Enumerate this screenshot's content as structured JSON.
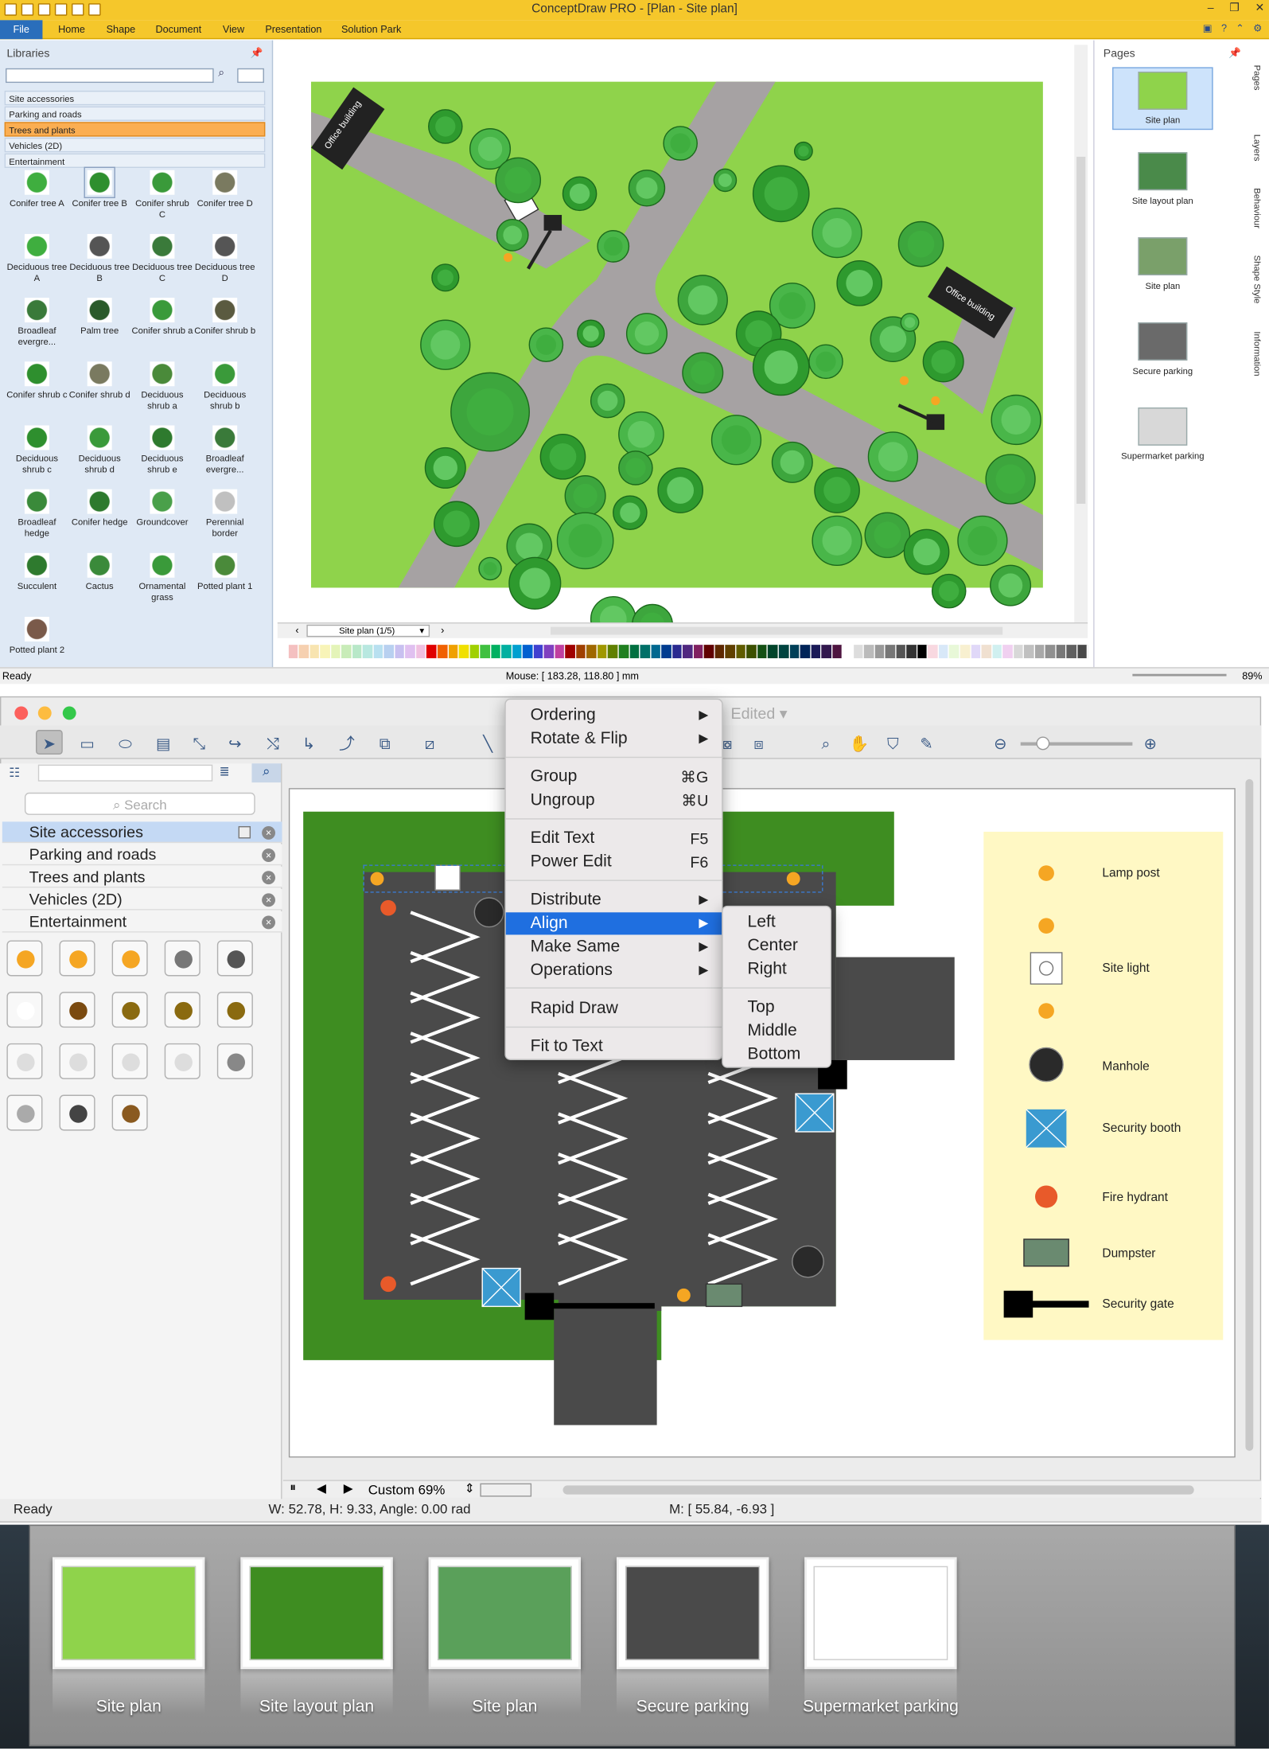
{
  "win": {
    "title": "ConceptDraw PRO - [Plan - Site plan]",
    "menu": [
      "File",
      "Home",
      "Shape",
      "Document",
      "View",
      "Presentation",
      "Solution Park"
    ],
    "libraries_header": "Libraries",
    "libraries": [
      {
        "label": "Site accessories",
        "selected": false
      },
      {
        "label": "Parking and roads",
        "selected": false
      },
      {
        "label": "Trees and plants",
        "selected": true
      },
      {
        "label": "Vehicles (2D)",
        "selected": false
      },
      {
        "label": "Entertainment",
        "selected": false
      }
    ],
    "shapes": [
      "Conifer tree A",
      "Conifer tree B",
      "Conifer shrub C",
      "Conifer tree D",
      "Deciduous tree A",
      "Deciduous tree B",
      "Deciduous tree C",
      "Deciduous tree D",
      "Broadleaf evergre...",
      "Palm tree",
      "Conifer shrub a",
      "Conifer shrub b",
      "Conifer shrub c",
      "Conifer shrub d",
      "Deciduous shrub a",
      "Deciduous shrub b",
      "Deciduous shrub c",
      "Deciduous shrub d",
      "Deciduous shrub e",
      "Broadleaf evergre...",
      "Broadleaf hedge",
      "Conifer hedge",
      "Groundcover",
      "Perennial border",
      "Succulent",
      "Cactus",
      "Ornamental grass",
      "Potted plant 1",
      "Potted plant 2"
    ],
    "plan_labels": [
      "Office building",
      "Office building"
    ],
    "pages_header": "Pages",
    "pages": [
      "Site plan",
      "Site layout plan",
      "Site plan",
      "Secure parking",
      "Supermarket parking"
    ],
    "side_tabs": [
      "Pages",
      "Layers",
      "Behaviour",
      "Shape Style",
      "Information"
    ],
    "page_tab": "Site plan (1/5)",
    "status_ready": "Ready",
    "status_mouse": "Mouse: [ 183.28, 118.80 ] mm",
    "zoom": "89%",
    "palette": [
      "#ffffff",
      "#f4c0c0",
      "#f6d0b0",
      "#f8e4b0",
      "#f8f4b8",
      "#e4f4b8",
      "#c8ecb8",
      "#b8e8c8",
      "#b8e8e0",
      "#b8e0f0",
      "#b8d0f0",
      "#c8c0f0",
      "#e0c0f0",
      "#f0c0e0",
      "#e00000",
      "#f06000",
      "#f0a000",
      "#f0e000",
      "#a0d000",
      "#40c040",
      "#00b060",
      "#00b0a0",
      "#00a0d0",
      "#0060d0",
      "#4040d0",
      "#8040c0",
      "#c040a0",
      "#a00000",
      "#a04000",
      "#a06800",
      "#a09800",
      "#608000",
      "#208020",
      "#007040",
      "#007068",
      "#006890",
      "#003c90",
      "#2a2a90",
      "#502880",
      "#802060",
      "#600000",
      "#5e2800",
      "#604000",
      "#605c00",
      "#3c5000",
      "#145014",
      "#00442a",
      "#004440",
      "#004058",
      "#002458",
      "#1a1a58",
      "#32184e",
      "#4e1440",
      "#ffffff",
      "#dddddd",
      "#bbbbbb",
      "#999999",
      "#777777",
      "#555555",
      "#333333",
      "#000000",
      "#f8d8e0",
      "#d8e8f8",
      "#e8f8d8",
      "#f8f0d0",
      "#e0d8f8",
      "#f0e0d0",
      "#d0f0f0",
      "#f0d0f0",
      "#d8d8d8",
      "#c0c0c0",
      "#a8a8a8",
      "#909090",
      "#787878",
      "#606060",
      "#484848"
    ]
  },
  "mac": {
    "title_suffix": "Edited",
    "search_placeholder": "Search",
    "libraries": [
      {
        "label": "Site accessories",
        "selected": true
      },
      {
        "label": "Parking and roads",
        "selected": false
      },
      {
        "label": "Trees and plants",
        "selected": false
      },
      {
        "label": "Vehicles (2D)",
        "selected": false
      },
      {
        "label": "Entertainment",
        "selected": false
      }
    ],
    "context_menu": [
      {
        "label": "Ordering",
        "shortcut": "",
        "submenu": true
      },
      {
        "label": "Rotate & Flip",
        "shortcut": "",
        "submenu": true
      },
      {
        "label": "Group",
        "shortcut": "⌘G",
        "submenu": false
      },
      {
        "label": "Ungroup",
        "shortcut": "⌘U",
        "submenu": false
      },
      {
        "label": "Edit Text",
        "shortcut": "F5",
        "submenu": false
      },
      {
        "label": "Power Edit",
        "shortcut": "F6",
        "submenu": false
      },
      {
        "label": "Distribute",
        "shortcut": "",
        "submenu": true
      },
      {
        "label": "Align",
        "shortcut": "",
        "submenu": true,
        "highlighted": true
      },
      {
        "label": "Make Same",
        "shortcut": "",
        "submenu": true
      },
      {
        "label": "Operations",
        "shortcut": "",
        "submenu": true
      },
      {
        "label": "Rapid Draw",
        "shortcut": "",
        "submenu": false
      },
      {
        "label": "Fit to Text",
        "shortcut": "",
        "submenu": false
      }
    ],
    "align_submenu": [
      "Left",
      "Center",
      "Right",
      "Top",
      "Middle",
      "Bottom"
    ],
    "legend": [
      "Lamp post",
      "Site light",
      "Manhole",
      "Security booth",
      "Fire hydrant",
      "Dumpster",
      "Security gate"
    ],
    "zoom_label": "Custom 69%",
    "status_ready": "Ready",
    "status_size": "W: 52.78,  H: 9.33,  Angle: 0.00 rad",
    "status_mouse": "M: [ 55.84, -6.93 ]",
    "pages": [
      "Site plan",
      "Site layout plan",
      "Site plan",
      "Secure parking",
      "Supermarket parking"
    ]
  },
  "colors": {
    "accent_orange": "#f5c72b",
    "grass": "#8fd34b",
    "road": "#a6a2a3",
    "hedge": "#3e8d21",
    "asphalt": "#4a4a4a",
    "highlight_blue": "#1f6fe0"
  }
}
